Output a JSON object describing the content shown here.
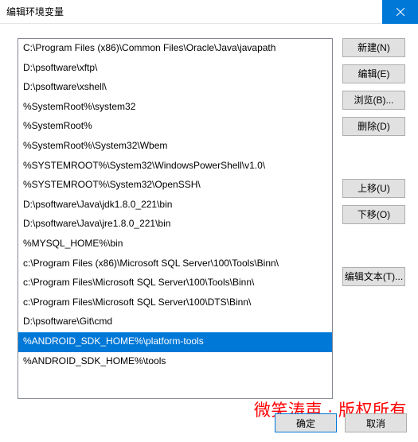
{
  "titlebar": {
    "title": "编辑环境变量"
  },
  "list": {
    "selectedIndex": 15,
    "items": [
      "C:\\Program Files (x86)\\Common Files\\Oracle\\Java\\javapath",
      "D:\\psoftware\\xftp\\",
      "D:\\psoftware\\xshell\\",
      "%SystemRoot%\\system32",
      "%SystemRoot%",
      "%SystemRoot%\\System32\\Wbem",
      "%SYSTEMROOT%\\System32\\WindowsPowerShell\\v1.0\\",
      "%SYSTEMROOT%\\System32\\OpenSSH\\",
      "D:\\psoftware\\Java\\jdk1.8.0_221\\bin",
      "D:\\psoftware\\Java\\jre1.8.0_221\\bin",
      "%MYSQL_HOME%\\bin",
      "c:\\Program Files (x86)\\Microsoft SQL Server\\100\\Tools\\Binn\\",
      "c:\\Program Files\\Microsoft SQL Server\\100\\Tools\\Binn\\",
      "c:\\Program Files\\Microsoft SQL Server\\100\\DTS\\Binn\\",
      "D:\\psoftware\\Git\\cmd",
      "%ANDROID_SDK_HOME%\\platform-tools",
      "%ANDROID_SDK_HOME%\\tools"
    ]
  },
  "buttons": {
    "new": "新建(N)",
    "edit": "编辑(E)",
    "browse": "浏览(B)...",
    "delete": "删除(D)",
    "moveUp": "上移(U)",
    "moveDown": "下移(O)",
    "editText": "编辑文本(T)..."
  },
  "footer": {
    "watermark": "微笑涛声 · 版权所有",
    "ok": "确定",
    "cancel": "取消"
  }
}
